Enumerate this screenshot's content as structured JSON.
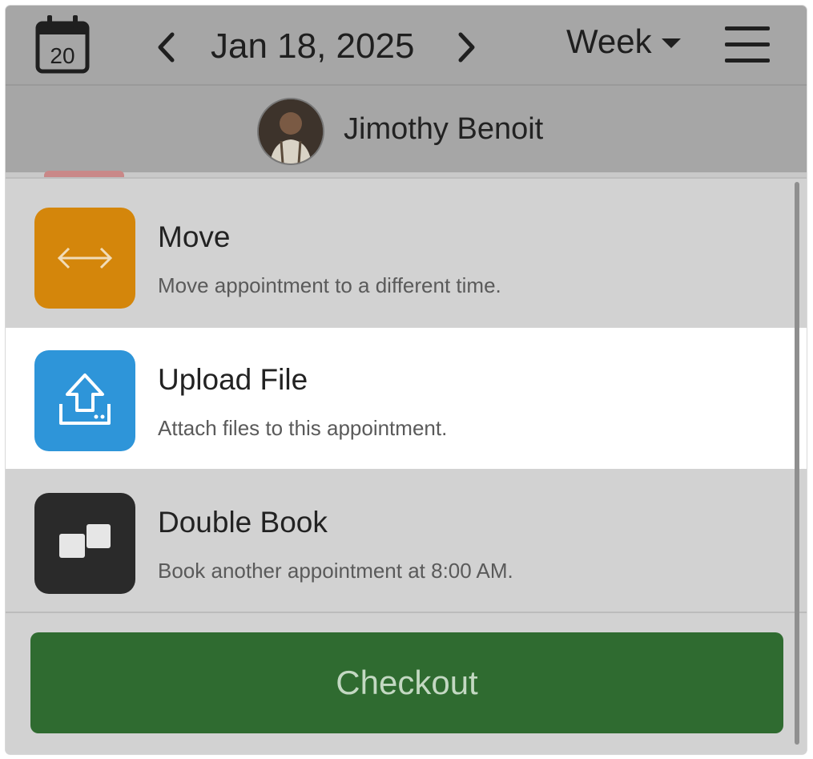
{
  "header": {
    "calendar_day": "20",
    "date": "Jan 18, 2025",
    "view": "Week"
  },
  "user": {
    "name": "Jimothy Benoit"
  },
  "actions": [
    {
      "title": "Move",
      "description": "Move appointment to a different time.",
      "icon": "arrow-left-right-icon",
      "color": "#d4860b"
    },
    {
      "title": "Upload File",
      "description": "Attach files to this appointment.",
      "icon": "upload-icon",
      "color": "#2e95d9"
    },
    {
      "title": "Double Book",
      "description": "Book another appointment at 8:00 AM.",
      "icon": "double-book-icon",
      "color": "#2a2a2a"
    }
  ],
  "checkout_label": "Checkout",
  "colors": {
    "accent_green": "#2f6b30",
    "overlay": "#a6a6a6"
  }
}
